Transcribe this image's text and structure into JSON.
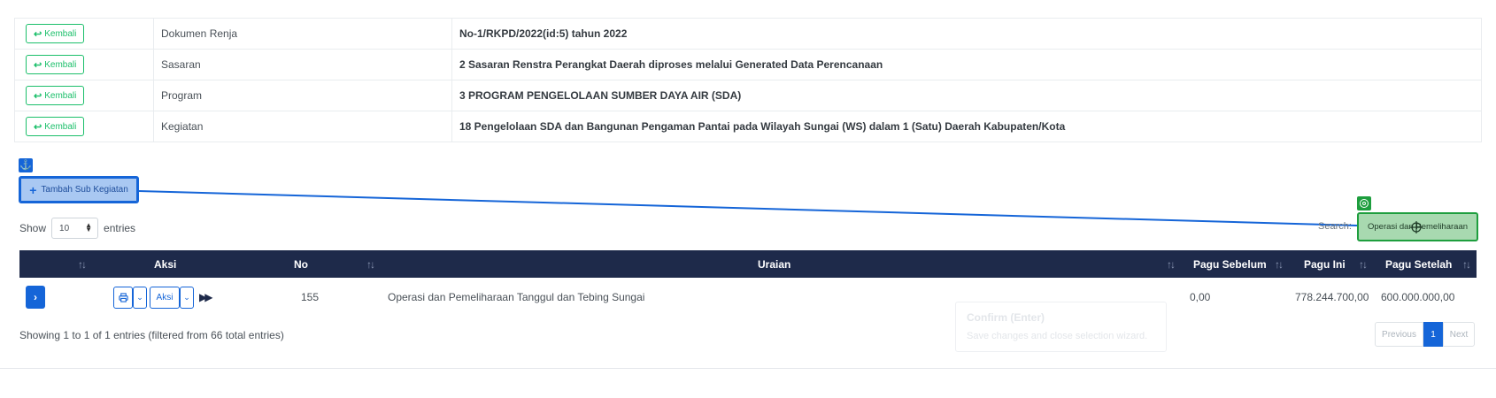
{
  "info_rows": [
    {
      "button": "Kembali",
      "label": "Dokumen Renja",
      "value": "No-1/RKPD/2022(id:5) tahun 2022"
    },
    {
      "button": "Kembali",
      "label": "Sasaran",
      "value": "2 Sasaran Renstra Perangkat Daerah diproses melalui Generated Data Perencanaan"
    },
    {
      "button": "Kembali",
      "label": "Program",
      "value": "3 PROGRAM PENGELOLAAN SUMBER DAYA AIR (SDA)"
    },
    {
      "button": "Kembali",
      "label": "Kegiatan",
      "value": "18 Pengelolaan SDA dan Bangunan Pengaman Pantai pada Wilayah Sungai (WS) dalam 1 (Satu) Daerah Kabupaten/Kota"
    }
  ],
  "add_button_label": "Tambah Sub Kegiatan",
  "length": {
    "prefix": "Show",
    "value": "10",
    "suffix": "entries"
  },
  "search": {
    "label": "Search:",
    "value": "Operasi dan Pemeliharaan"
  },
  "table": {
    "columns": [
      "",
      "Aksi",
      "No",
      "Uraian",
      "Pagu Sebelum",
      "Pagu Ini",
      "Pagu Setelah"
    ],
    "rows": [
      {
        "aksi_label": "Aksi",
        "no": "155",
        "uraian": "Operasi dan Pemeliharaan Tanggul dan Tebing Sungai",
        "pagu_sebelum": "0,00",
        "pagu_ini": "778.244.700,00",
        "pagu_setelah": "600.000.000,00"
      }
    ]
  },
  "info_text": "Showing 1 to 1 of 1 entries (filtered from 66 total entries)",
  "pagination": {
    "previous": "Previous",
    "current": "1",
    "next": "Next"
  },
  "tooltip": {
    "title": "Confirm (Enter)",
    "text": "Save changes and close selection wizard."
  },
  "colors": {
    "primary": "#1565d8",
    "success": "#1bbf6a",
    "header_bg": "#1e2a4a",
    "anchor_highlight": "#a9c8f2",
    "target_highlight": "#a8d9b0"
  },
  "icons": {
    "back": "reply-arrow-icon",
    "add": "plus-icon",
    "anchor": "anchor-icon",
    "target": "target-icon",
    "expand": "chevron-right-icon",
    "print": "printer-icon",
    "dropdown": "chevron-down-icon",
    "forward": "fast-forward-icon",
    "sort": "sort-arrows-icon"
  }
}
